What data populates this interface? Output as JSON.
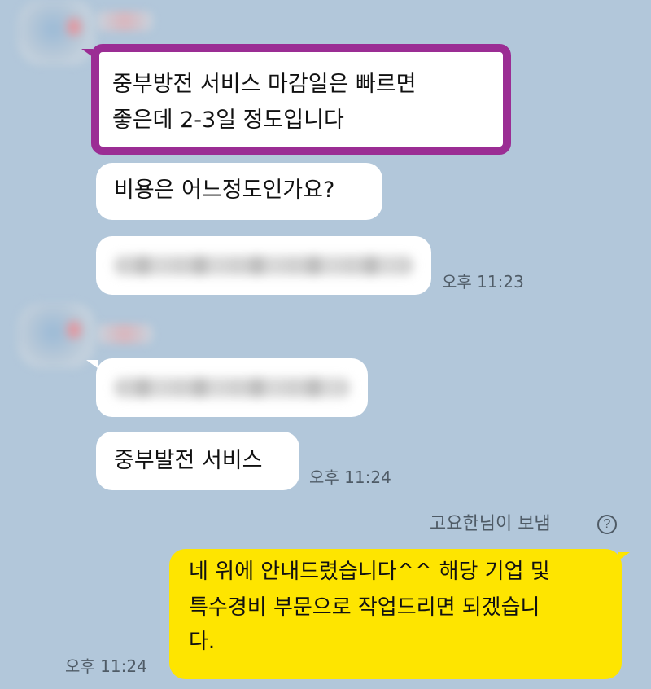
{
  "messages": {
    "highlighted": {
      "line1": "중부방전 서비스 마감일은 빠르면",
      "line2": "좋은데 2-3일 정도입니다"
    },
    "cost_question": "비용은 어느정도인가요?",
    "time_1": "오후 11:23",
    "service_name": "중부발전 서비스",
    "time_2": "오후 11:24"
  },
  "sent": {
    "label": "고요한님이 보냄",
    "icon": "question-circle-icon",
    "line1": "네 위에 안내드렸습니다^^ 해당 기업 및",
    "line2": "특수경비 부문으로 작업드리면 되겠습니",
    "line3": "다.",
    "time": "오후 11:24"
  },
  "colors": {
    "background": "#b2c7da",
    "incoming_bubble": "#ffffff",
    "outgoing_bubble": "#fee500",
    "highlight_border": "#9b2d94"
  }
}
